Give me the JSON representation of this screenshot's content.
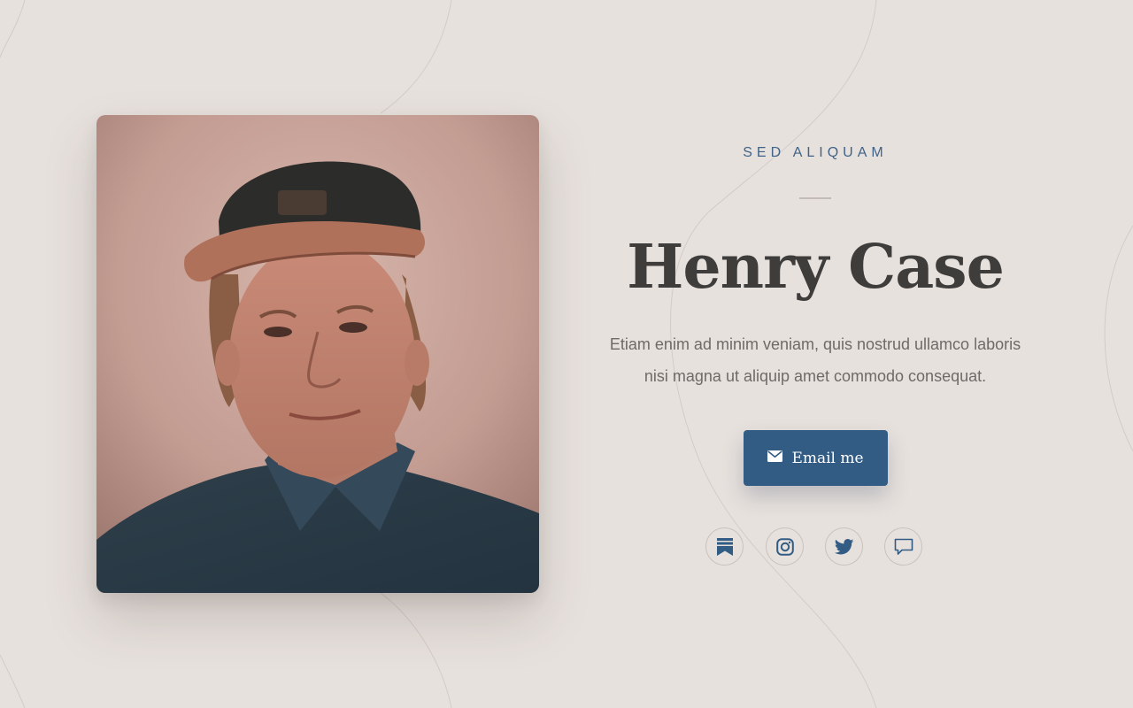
{
  "profile": {
    "eyebrow": "SED ALIQUAM",
    "name": "Henry Case",
    "bio_line1": "Etiam enim ad minim veniam, quis nostrud ullamco laboris",
    "bio_line2": "nisi magna ut aliquip amet commodo consequat.",
    "photo_alt": "Portrait of Henry Case"
  },
  "actions": {
    "email_label": "Email me",
    "email_icon": "envelope-icon"
  },
  "socials": [
    {
      "name": "bookmark-icon"
    },
    {
      "name": "instagram-icon"
    },
    {
      "name": "twitter-icon"
    },
    {
      "name": "chat-bubble-icon"
    }
  ],
  "colors": {
    "background": "#e7e1dd",
    "accent": "#325c84",
    "heading": "#3f3d3c",
    "body_text": "#6f6a67",
    "eyebrow": "#3f6389"
  }
}
